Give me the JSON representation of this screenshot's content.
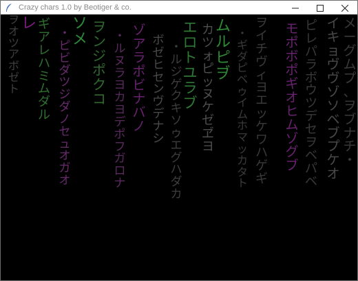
{
  "window": {
    "title": "Crazy chars 1.0 by Beotiger & co.",
    "icon": "feather-icon",
    "controls": {
      "minimize_icon": "minimize-icon",
      "maximize_icon": "maximize-icon",
      "close_icon": "close-icon"
    }
  },
  "colors": {
    "background": "#000000",
    "green": "#3a8f3e",
    "purple": "#6a1f73",
    "gray": "#4a4a4a",
    "title_text": "#8a8a8a"
  },
  "rain": {
    "columns": [
      {
        "chars": [
          "ヲ",
          "オ",
          "ツ",
          "ア",
          "ボ",
          "ゼ",
          "ト"
        ],
        "color": "#3f3f3f"
      },
      {
        "chars": [
          "レ"
        ],
        "color": "#7a1c7c"
      },
      {
        "chars": [
          "ギ",
          "ア",
          "レ",
          "ハ",
          "ミ",
          "ム",
          "ダ",
          "ル"
        ],
        "color": "#2f6f2f"
      },
      {
        "chars": [
          "・",
          "ピ",
          "ビ",
          "ダ",
          "ツ",
          "ジ",
          "ダ",
          "ノ",
          "セ",
          "ュ",
          "オ",
          "ガ",
          "オ"
        ],
        "color": "#6a2a6e"
      },
      {
        "chars": [
          "ソ",
          "メ"
        ],
        "color": "#2e8a3a"
      },
      {
        "chars": [
          "ヲ",
          "ン",
          "ジ",
          "ポ",
          "ク",
          "コ"
        ],
        "color": "#2f6a2f"
      },
      {
        "chars": [
          "・",
          "ル",
          "ヌ",
          "ラ",
          "ヨ",
          "カ",
          "ヨ",
          "デ",
          "ポ",
          "フ",
          "ガ",
          "ロ",
          "ナ"
        ],
        "color": "#5a2a5e"
      },
      {
        "chars": [
          "ゾ",
          "ア",
          "ラ",
          "ポ",
          "ビ",
          "ナ",
          "バ",
          "ノ"
        ],
        "color": "#6a2270"
      },
      {
        "chars": [
          "ボ",
          "ゼ",
          "ヒ",
          "セ",
          "ン",
          "ヴ",
          "デ",
          "ナ",
          "シ"
        ],
        "color": "#4a4a4a"
      },
      {
        "chars": [
          "・",
          "ル",
          "ジ",
          "ゲ",
          "ク",
          "キ",
          "ソ",
          "ゥ",
          "エ",
          "グ",
          "ハ",
          "ダ",
          "カ"
        ],
        "color": "#3e3e3e"
      },
      {
        "chars": [
          "エ",
          "ロ",
          "ト",
          "ユ",
          "ラ",
          "ブ"
        ],
        "color": "#2e7a35"
      },
      {
        "chars": [
          "カ",
          "ツ",
          "ォ",
          "ピ",
          "ッ",
          "ヌ",
          "ケ",
          "ゼ",
          "ヹ",
          "ヨ"
        ],
        "color": "#4e4e4e"
      },
      {
        "chars": [
          "ム",
          "ル",
          "ピ",
          "ヺ"
        ],
        "color": "#2e8a35"
      },
      {
        "chars": [
          "・",
          "ギ",
          "ダ",
          "ピ",
          "ベ",
          "ゥ",
          "イ",
          "ム",
          "ホ",
          "マ",
          "ッ",
          "カ",
          "タ",
          "ト"
        ],
        "color": "#3a3a3a"
      },
      {
        "chars": [
          "ヲ",
          "イ",
          "チ",
          "ヴ",
          "ィ",
          "ヨ",
          "エ",
          "ッ",
          "ケ",
          "ワ",
          "ハ",
          "ゲ",
          "ギ"
        ],
        "color": "#3a3a3a"
      },
      {
        "chars": [
          "モ",
          "ポ",
          "ボ",
          "ポ",
          "ギ",
          "オ",
          "ヒ",
          "ム",
          "ゾ",
          "グ",
          "ブ"
        ],
        "color": "#6a2270"
      },
      {
        "chars": [
          "ピ",
          "レ",
          "パ",
          "ラ",
          "ボ",
          "ウ",
          "ツ",
          "デ",
          "セ",
          "ヲ",
          "ベ",
          "パ",
          "ベ"
        ],
        "color": "#3a3a3a"
      },
      {
        "chars": [
          "イ",
          "キ",
          "ョ",
          "ヴ",
          "ヴ",
          "ゾ",
          "ソ",
          "ベ",
          "ブ",
          "プ",
          "ケ",
          "オ"
        ],
        "color": "#4a4a4a"
      },
      {
        "chars": [
          "メ",
          "ー",
          "グ",
          "ム",
          "プ",
          "、",
          "ヲ",
          "ブ",
          "ナ",
          "チ",
          "・"
        ],
        "color": "#3a3a3a"
      }
    ]
  }
}
